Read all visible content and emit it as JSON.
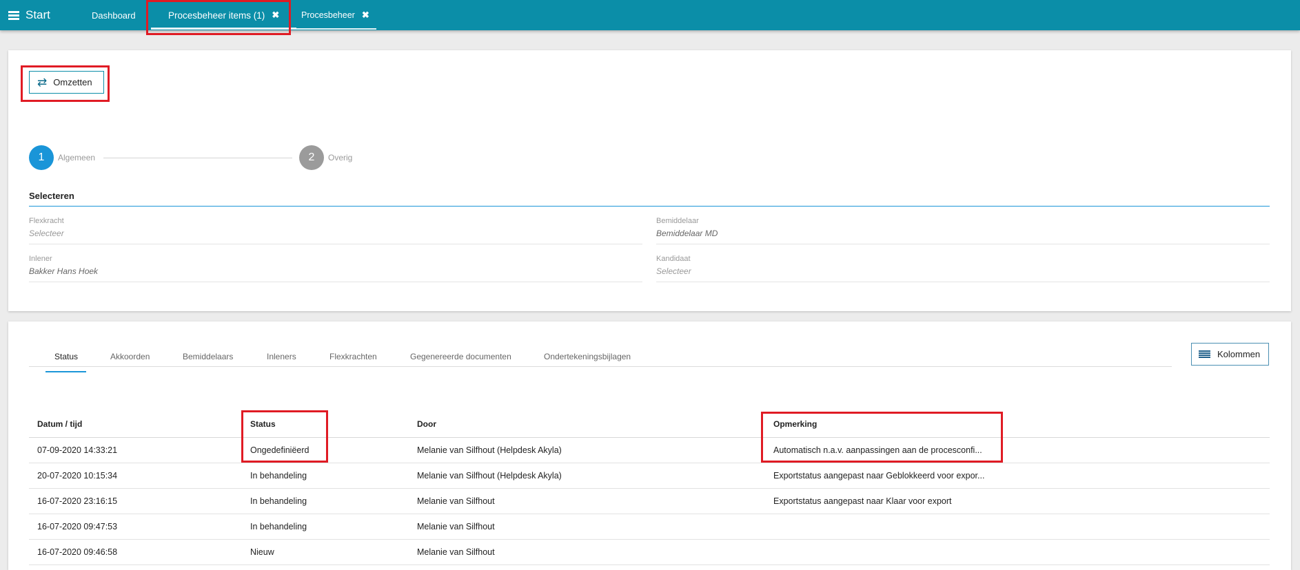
{
  "topbar": {
    "menu_label": "Start",
    "tabs": [
      {
        "label": "Dashboard"
      },
      {
        "label": "Procesbeheer items (1)",
        "close": "✖"
      },
      {
        "label": "Procesbeheer",
        "close": "✖"
      }
    ]
  },
  "toolbar": {
    "omzetten_label": "Omzetten",
    "omzetten_icon": "swap-arrows-icon"
  },
  "stepper": [
    {
      "number": "1",
      "label": "Algemeen",
      "color": "#1a95d8"
    },
    {
      "number": "2",
      "label": "Overig",
      "color": "#9b9b9b"
    }
  ],
  "selection": {
    "title": "Selecteren",
    "fields": {
      "flexkracht": {
        "label": "Flexkracht",
        "value": "Selecteer"
      },
      "bemiddelaar": {
        "label": "Bemiddelaar",
        "value": "Bemiddelaar MD"
      },
      "inlener": {
        "label": "Inlener",
        "value": "Bakker Hans Hoek"
      },
      "kandidaat": {
        "label": "Kandidaat",
        "value": "Selecteer"
      }
    }
  },
  "subtabs": [
    "Status",
    "Akkoorden",
    "Bemiddelaars",
    "Inleners",
    "Flexkrachten",
    "Gegenereerde documenten",
    "Ondertekeningsbijlagen"
  ],
  "kolommen_label": "Kolommen",
  "table": {
    "columns": [
      "Datum / tijd",
      "Status",
      "Door",
      "Opmerking"
    ],
    "rows": [
      [
        "07-09-2020 14:33:21",
        "Ongedefiniëerd",
        "Melanie van Silfhout (Helpdesk Akyla)",
        "Automatisch n.a.v. aanpassingen aan de procesconfi..."
      ],
      [
        "20-07-2020 10:15:34",
        "In behandeling",
        "Melanie van Silfhout (Helpdesk Akyla)",
        "Exportstatus aangepast naar Geblokkeerd voor expor..."
      ],
      [
        "16-07-2020 23:16:15",
        "In behandeling",
        "Melanie van Silfhout",
        "Exportstatus aangepast naar Klaar voor export"
      ],
      [
        "16-07-2020 09:47:53",
        "In behandeling",
        "Melanie van Silfhout",
        ""
      ],
      [
        "16-07-2020 09:46:58",
        "Nieuw",
        "Melanie van Silfhout",
        ""
      ]
    ]
  },
  "colors": {
    "topbar": "#0b8ea8",
    "accent": "#1a95d8",
    "highlight": "#e01b24"
  }
}
